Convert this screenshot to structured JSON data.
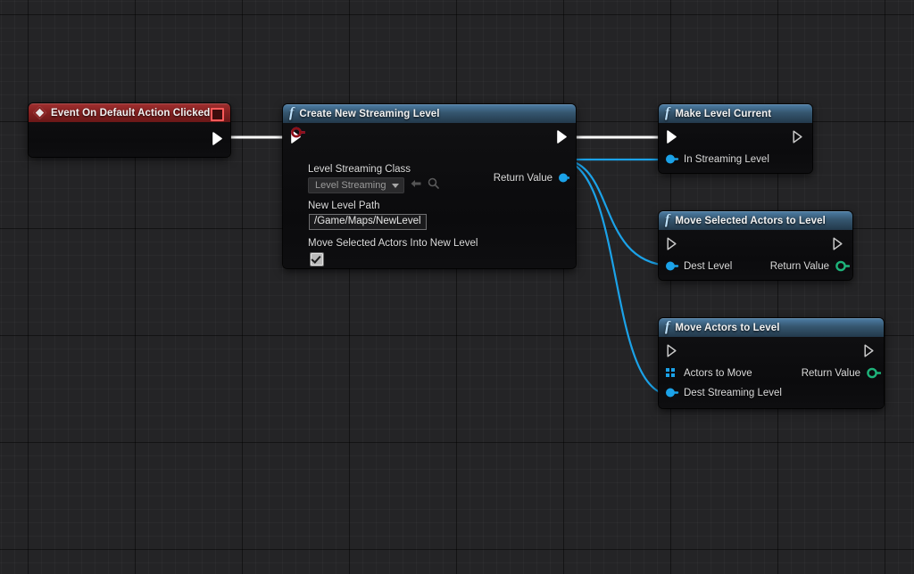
{
  "graph": {
    "background_color": "#242426",
    "grid_minor_color": "#2b2b2d",
    "grid_major_color": "#000000",
    "exec_wire_color": "#ffffff",
    "object_wire_color": "#1ba2e8"
  },
  "nodes": [
    {
      "id": "event-on-default-action-clicked",
      "type": "event",
      "title": "Event On Default Action Clicked",
      "header_color": "#8a2323",
      "left_icon": "diamond-icon",
      "right_icon": "stop-square-icon",
      "pins": {
        "exec_out": {
          "label": "",
          "kind": "exec",
          "filled": true
        }
      }
    },
    {
      "id": "create-new-streaming-level",
      "type": "function",
      "title": "Create New Streaming Level",
      "header_color": "#35566f",
      "pins": {
        "exec_in": {
          "label": "",
          "kind": "exec",
          "filled": true
        },
        "exec_out": {
          "label": "",
          "kind": "exec",
          "filled": true
        },
        "inputs": [
          {
            "label": "Level Streaming Class",
            "kind": "class",
            "color": "#7b20c8",
            "widget": {
              "type": "dropdown",
              "value": "Level Streaming",
              "icons": [
                "back-arrow-icon",
                "browse-search-icon"
              ]
            }
          },
          {
            "label": "New Level Path",
            "kind": "string",
            "color": "#e222c8",
            "widget": {
              "type": "textbox",
              "value": "/Game/Maps/NewLevel"
            }
          },
          {
            "label": "Move Selected Actors Into New Level",
            "kind": "boolean",
            "color": "#8c1212",
            "widget": {
              "type": "checkbox",
              "checked": true
            }
          }
        ],
        "outputs": [
          {
            "label": "Return Value",
            "kind": "object",
            "color": "#1ba2e8",
            "connected": true
          }
        ]
      }
    },
    {
      "id": "make-level-current",
      "type": "function",
      "title": "Make Level Current",
      "header_color": "#35566f",
      "pins": {
        "exec_in": {
          "label": "",
          "kind": "exec",
          "filled": true
        },
        "exec_out": {
          "label": "",
          "kind": "exec",
          "filled": false
        },
        "inputs": [
          {
            "label": "In Streaming Level",
            "kind": "object",
            "color": "#1ba2e8",
            "connected": true
          }
        ],
        "outputs": []
      }
    },
    {
      "id": "move-selected-actors-to-level",
      "type": "function",
      "title": "Move Selected Actors to Level",
      "header_color": "#35566f",
      "pins": {
        "exec_in": {
          "label": "",
          "kind": "exec",
          "filled": false
        },
        "exec_out": {
          "label": "",
          "kind": "exec",
          "filled": false
        },
        "inputs": [
          {
            "label": "Dest Level",
            "kind": "object",
            "color": "#1ba2e8",
            "connected": true
          }
        ],
        "outputs": [
          {
            "label": "Return Value",
            "kind": "integer",
            "color": "#1eb37a",
            "connected": false
          }
        ]
      }
    },
    {
      "id": "move-actors-to-level",
      "type": "function",
      "title": "Move Actors to Level",
      "header_color": "#35566f",
      "pins": {
        "exec_in": {
          "label": "",
          "kind": "exec",
          "filled": false
        },
        "exec_out": {
          "label": "",
          "kind": "exec",
          "filled": false
        },
        "inputs": [
          {
            "label": "Actors to Move",
            "kind": "array",
            "color": "#1ba2e8",
            "connected": false
          },
          {
            "label": "Dest Streaming Level",
            "kind": "object",
            "color": "#1ba2e8",
            "connected": true
          }
        ],
        "outputs": [
          {
            "label": "Return Value",
            "kind": "integer",
            "color": "#1eb37a",
            "connected": false
          }
        ]
      }
    }
  ],
  "connections": [
    {
      "from": "event-on-default-action-clicked.exec_out",
      "to": "create-new-streaming-level.exec_in",
      "color": "#ffffff"
    },
    {
      "from": "create-new-streaming-level.exec_out",
      "to": "make-level-current.exec_in",
      "color": "#ffffff"
    },
    {
      "from": "create-new-streaming-level.Return Value",
      "to": "make-level-current.In Streaming Level",
      "color": "#1ba2e8"
    },
    {
      "from": "create-new-streaming-level.Return Value",
      "to": "move-selected-actors-to-level.Dest Level",
      "color": "#1ba2e8"
    },
    {
      "from": "create-new-streaming-level.Return Value",
      "to": "move-actors-to-level.Dest Streaming Level",
      "color": "#1ba2e8"
    }
  ]
}
